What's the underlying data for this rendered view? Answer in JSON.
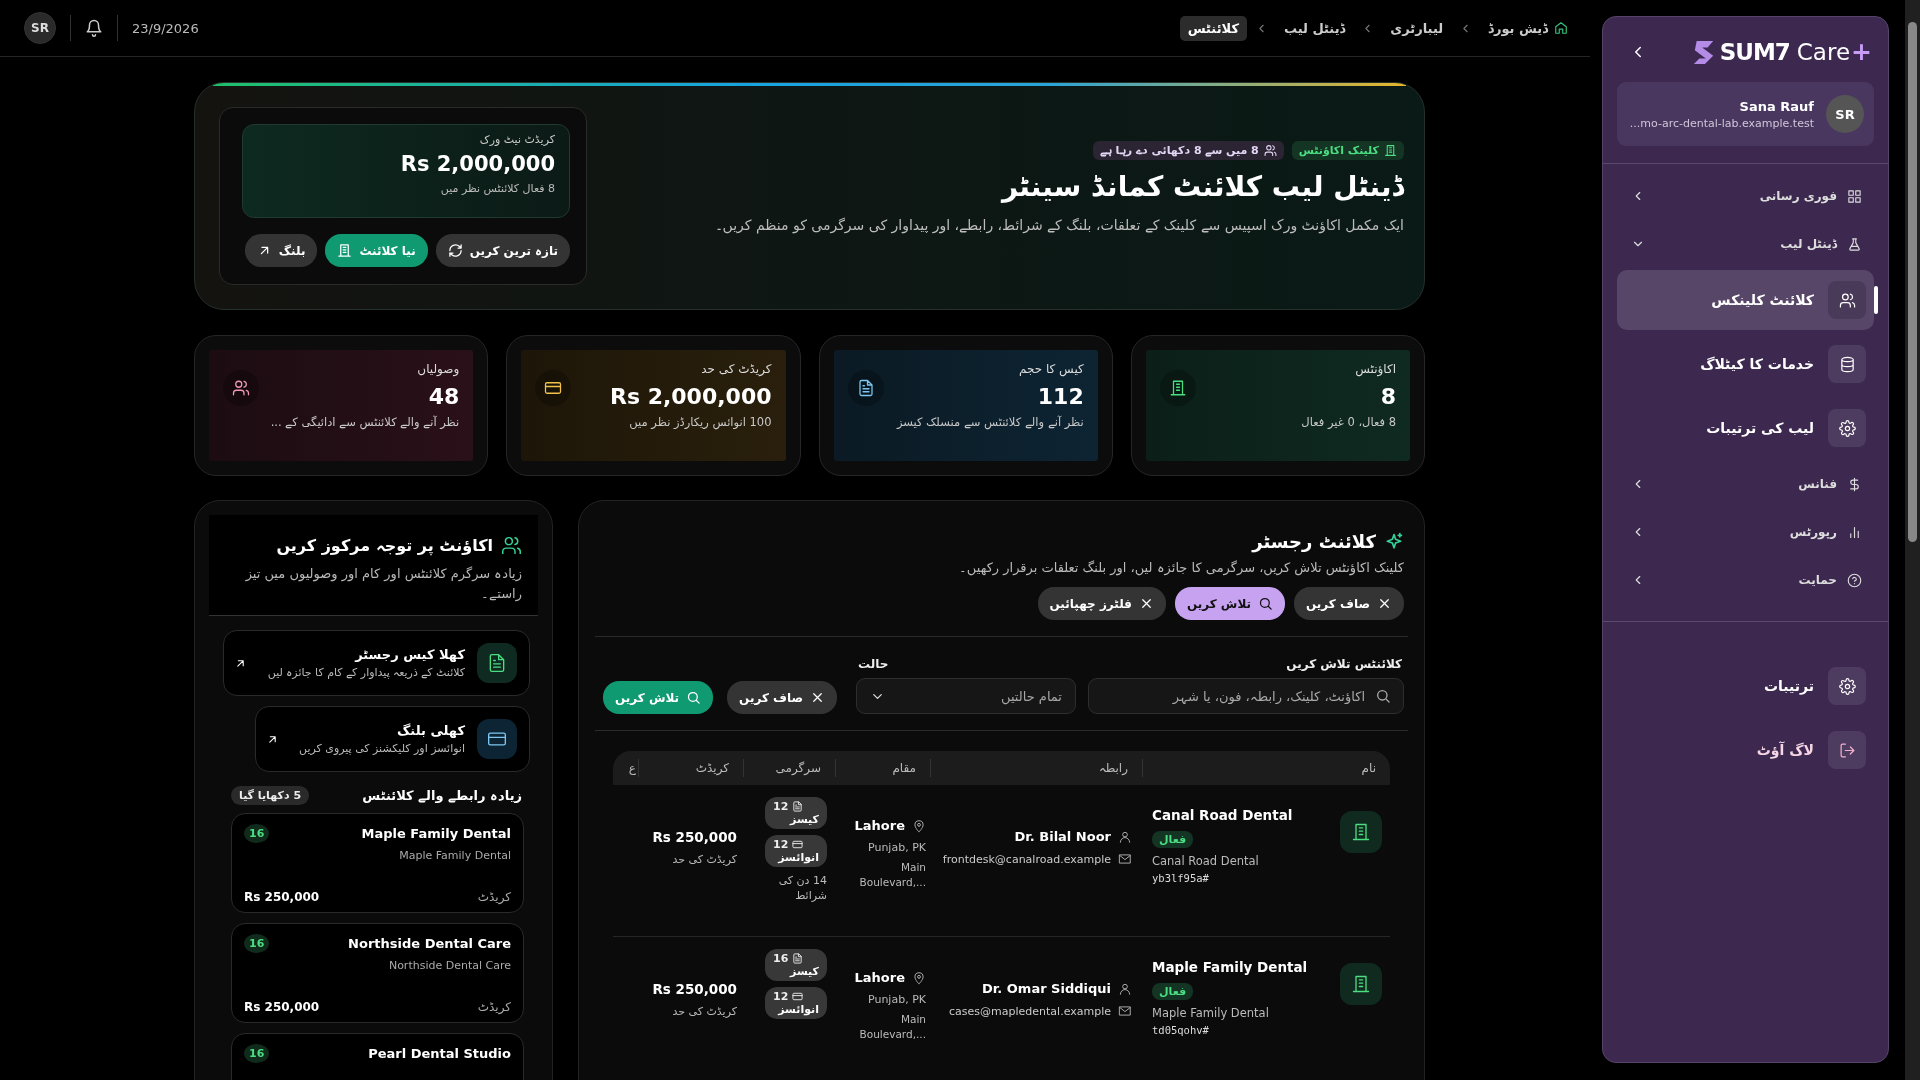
{
  "topbar": {
    "avatar": "SR",
    "date": "23/9/2026",
    "breadcrumbs": [
      {
        "label": "ڈیش بورڈ",
        "kind": "home",
        "selected": false
      },
      {
        "label": "لیبارٹری",
        "kind": "page",
        "selected": false
      },
      {
        "label": "ڈینٹل لیب",
        "kind": "page",
        "selected": false
      },
      {
        "label": "کلائنٹس",
        "kind": "page",
        "selected": true
      }
    ]
  },
  "hero": {
    "badges": [
      {
        "label": "کلینک اکاؤنٹس",
        "kind": "accounts"
      },
      {
        "label": "8 میں سے 8 دکھائی دے رہا ہے",
        "kind": "visible"
      }
    ],
    "title": "ڈینٹل لیب کلائنٹ کمانڈ سینٹر",
    "description": "ایک مکمل اکاؤنٹ ورک اسپیس سے کلینک کے تعلقات، بلنگ کے شرائط، رابطے، اور پیداوار کی سرگرمی کو منظم کریں۔",
    "summary": {
      "label": "کریڈٹ نیٹ ورک",
      "value": "Rs 2,000,000",
      "note": "8 فعال کلائنٹس نظر میں"
    },
    "buttons": [
      {
        "label": "تازہ ترین کریں",
        "kind": "refresh"
      },
      {
        "label": "نیا کلائنٹ",
        "kind": "new"
      },
      {
        "label": "بلنگ",
        "kind": "billing"
      }
    ]
  },
  "stats": [
    {
      "label": "اکاؤنٹس",
      "value": "8",
      "note": "8 فعال، 0 غیر فعال",
      "kind": "accounts"
    },
    {
      "label": "کیس کا حجم",
      "value": "112",
      "note": "نظر آنے والے کلائنٹس سے منسلک کیسز",
      "kind": "cases"
    },
    {
      "label": "کریڈٹ کی حد",
      "value": "Rs 2,000,000",
      "note": "100 انوائس ریکارڈز نظر میں",
      "kind": "credit"
    },
    {
      "label": "وصولیاں",
      "value": "48",
      "note": "نظر آنے والے کلائنٹس سے ادائیگی کے ...",
      "kind": "collections"
    }
  ],
  "register": {
    "title": "کلائنٹ رجسٹر",
    "description": "کلینک اکاؤنٹس تلاش کریں، سرگرمی کا جائزہ لیں، اور بلنگ تعلقات برقرار رکھیں۔",
    "actions": [
      {
        "label": "صاف کریں",
        "kind": "clear"
      },
      {
        "label": "تلاش کریں",
        "kind": "search"
      },
      {
        "label": "فلٹرز چھپائیں",
        "kind": "hide"
      }
    ],
    "search": {
      "label": "کلائنٹس تلاش کریں",
      "placeholder": "اکاؤنٹ، کلینک، رابطہ، فون، یا شہر"
    },
    "status": {
      "label": "حالت",
      "value": "تمام حالتیں"
    },
    "filter_buttons": [
      {
        "label": "صاف کریں",
        "kind": "clear"
      },
      {
        "label": "تلاش کریں",
        "kind": "go"
      }
    ],
    "table": {
      "columns": [
        "نام",
        "رابطہ",
        "مقام",
        "سرگرمی",
        "کریڈٹ",
        "ع"
      ],
      "rows": [
        {
          "name": "Canal Road Dental",
          "status": "فعال",
          "clinic": "Canal Road Dental",
          "code": "#yb3lf95a",
          "contact": "Dr. Bilal Noor",
          "email": "frontdesk@canalroad.example",
          "city": "Lahore",
          "region": "Punjab, PK",
          "address": "Main Boulevard,...",
          "activity": [
            {
              "count": "12",
              "label": "کیسز",
              "kind": "cases"
            },
            {
              "count": "12",
              "label": "انوائسز",
              "kind": "invoices"
            }
          ],
          "terms": "14 دن کی شرائط",
          "credit": "Rs 250,000",
          "credit_label": "کریڈٹ کی حد"
        },
        {
          "name": "Maple Family Dental",
          "status": "فعال",
          "clinic": "Maple Family Dental",
          "code": "#td05qohv",
          "contact": "Dr. Omar Siddiqui",
          "email": "cases@mapledental.example",
          "city": "Lahore",
          "region": "Punjab, PK",
          "address": "Main Boulevard,...",
          "activity": [
            {
              "count": "16",
              "label": "کیسز",
              "kind": "cases"
            },
            {
              "count": "12",
              "label": "انوائسز",
              "kind": "invoices"
            }
          ],
          "credit": "Rs 250,000",
          "credit_label": "کریڈٹ کی حد"
        }
      ]
    }
  },
  "focus": {
    "title": "اکاؤنٹ پر توجہ مرکوز کریں",
    "description": "زیادہ سرگرم کلائنٹس اور کام اور وصولیوں میں تیز راستے۔",
    "links": [
      {
        "title": "کھلا کیس رجسٹر",
        "subtitle": "کلائنٹ کے ذریعہ پیداوار کے کام کا جائزہ لیں",
        "kind": "cases"
      },
      {
        "title": "کھلی بلنگ",
        "subtitle": "انوائسز اور کلیکشنز کی پیروی کریں",
        "kind": "billing"
      }
    ],
    "clients_title": "زیادہ رابطے والے کلائنٹس",
    "clients_badge": "5 دکھایا گیا",
    "clients": [
      {
        "name": "Maple Family Dental",
        "clinic": "Maple Family Dental",
        "label": "کریڈٹ",
        "amount": "Rs 250,000",
        "count": "16"
      },
      {
        "name": "Northside Dental Care",
        "clinic": "Northside Dental Care",
        "label": "کریڈٹ",
        "amount": "Rs 250,000",
        "count": "16"
      },
      {
        "name": "Pearl Dental Studio",
        "count": "16"
      }
    ]
  },
  "sidebar": {
    "brand": {
      "name": "SUM7",
      "product": "Care",
      "mark": "+"
    },
    "user": {
      "name": "Sana Rauf",
      "email": "...mo-arc-dental-lab.example.test",
      "initials": "SR"
    },
    "nav": [
      {
        "label": "فوری رسانی",
        "kind": "quick",
        "expanded": false
      },
      {
        "label": "ڈینٹل لیب",
        "kind": "lab",
        "expanded": true,
        "children": [
          {
            "label": "کلائنٹ کلینکس",
            "kind": "clients",
            "selected": true
          },
          {
            "label": "خدمات کا کیٹلاگ",
            "kind": "catalog",
            "selected": false
          },
          {
            "label": "لیب کی ترتیبات",
            "kind": "settings",
            "selected": false
          }
        ]
      },
      {
        "label": "فنانس",
        "kind": "finance",
        "expanded": false
      },
      {
        "label": "رپورٹس",
        "kind": "reports",
        "expanded": false
      },
      {
        "label": "حمایت",
        "kind": "support",
        "expanded": false
      }
    ],
    "footer": [
      {
        "label": "ترتیبات",
        "kind": "settings"
      },
      {
        "label": "لاگ آؤٹ",
        "kind": "logout"
      }
    ]
  }
}
